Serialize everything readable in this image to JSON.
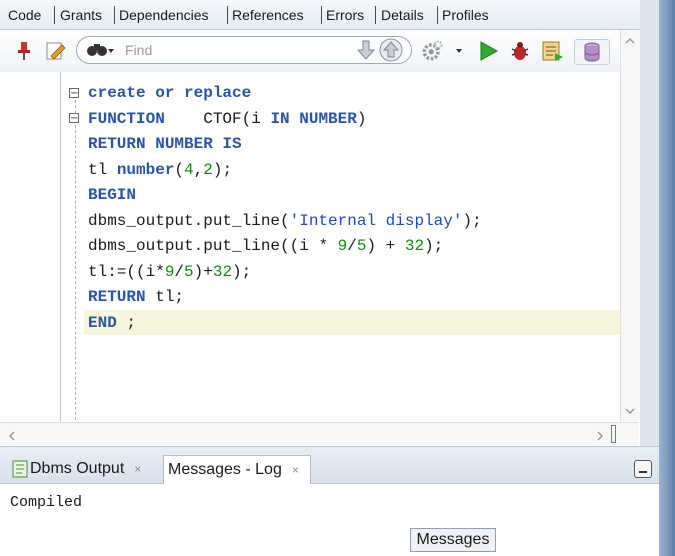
{
  "tabs": [
    {
      "label": "Code"
    },
    {
      "label": "Grants"
    },
    {
      "label": "Dependencies"
    },
    {
      "label": "References"
    },
    {
      "label": "Errors"
    },
    {
      "label": "Details"
    },
    {
      "label": "Profiles"
    }
  ],
  "toolbar": {
    "find_placeholder": "Find",
    "icons": [
      "pin-icon",
      "edit-icon",
      "binoculars-icon",
      "arrow-down-icon",
      "arrow-up-icon",
      "gear-icon",
      "run-icon",
      "debug-icon",
      "compile-icon",
      "database-icon"
    ]
  },
  "editor": {
    "lines": [
      [
        {
          "t": "create or replace",
          "c": "kw"
        }
      ],
      [
        {
          "t": "FUNCTION",
          "c": "kw"
        },
        {
          "t": "    CTOF(i ",
          "c": ""
        },
        {
          "t": "IN NUMBER",
          "c": "kw"
        },
        {
          "t": ")",
          "c": ""
        }
      ],
      [
        {
          "t": "RETURN NUMBER IS",
          "c": "kw"
        }
      ],
      [
        {
          "t": "tl ",
          "c": ""
        },
        {
          "t": "number",
          "c": "kw"
        },
        {
          "t": "(",
          "c": ""
        },
        {
          "t": "4",
          "c": "num"
        },
        {
          "t": ",",
          "c": ""
        },
        {
          "t": "2",
          "c": "num"
        },
        {
          "t": ");",
          "c": ""
        }
      ],
      [
        {
          "t": "BEGIN",
          "c": "kw"
        }
      ],
      [
        {
          "t": "dbms_output.put_line(",
          "c": ""
        },
        {
          "t": "'Internal display'",
          "c": "str"
        },
        {
          "t": ");",
          "c": ""
        }
      ],
      [
        {
          "t": "dbms_output.put_line((i * ",
          "c": ""
        },
        {
          "t": "9",
          "c": "num"
        },
        {
          "t": "/",
          "c": ""
        },
        {
          "t": "5",
          "c": "num"
        },
        {
          "t": ") + ",
          "c": ""
        },
        {
          "t": "32",
          "c": "num"
        },
        {
          "t": ");",
          "c": ""
        }
      ],
      [
        {
          "t": "tl:=((i*",
          "c": ""
        },
        {
          "t": "9",
          "c": "num"
        },
        {
          "t": "/",
          "c": ""
        },
        {
          "t": "5",
          "c": "num"
        },
        {
          "t": ")+",
          "c": ""
        },
        {
          "t": "32",
          "c": "num"
        },
        {
          "t": ");",
          "c": ""
        }
      ],
      [
        {
          "t": "RETURN",
          "c": "kw"
        },
        {
          "t": " tl;",
          "c": ""
        }
      ],
      [
        {
          "t": "END",
          "c": "kw"
        },
        {
          "t": " ;",
          "c": ""
        }
      ]
    ]
  },
  "bottom_panel": {
    "tabs": [
      {
        "label": "Dbms Output",
        "close": "×"
      },
      {
        "label": "Messages - Log",
        "close": "×"
      }
    ],
    "log_text": "Compiled",
    "tooltip": "Messages"
  }
}
